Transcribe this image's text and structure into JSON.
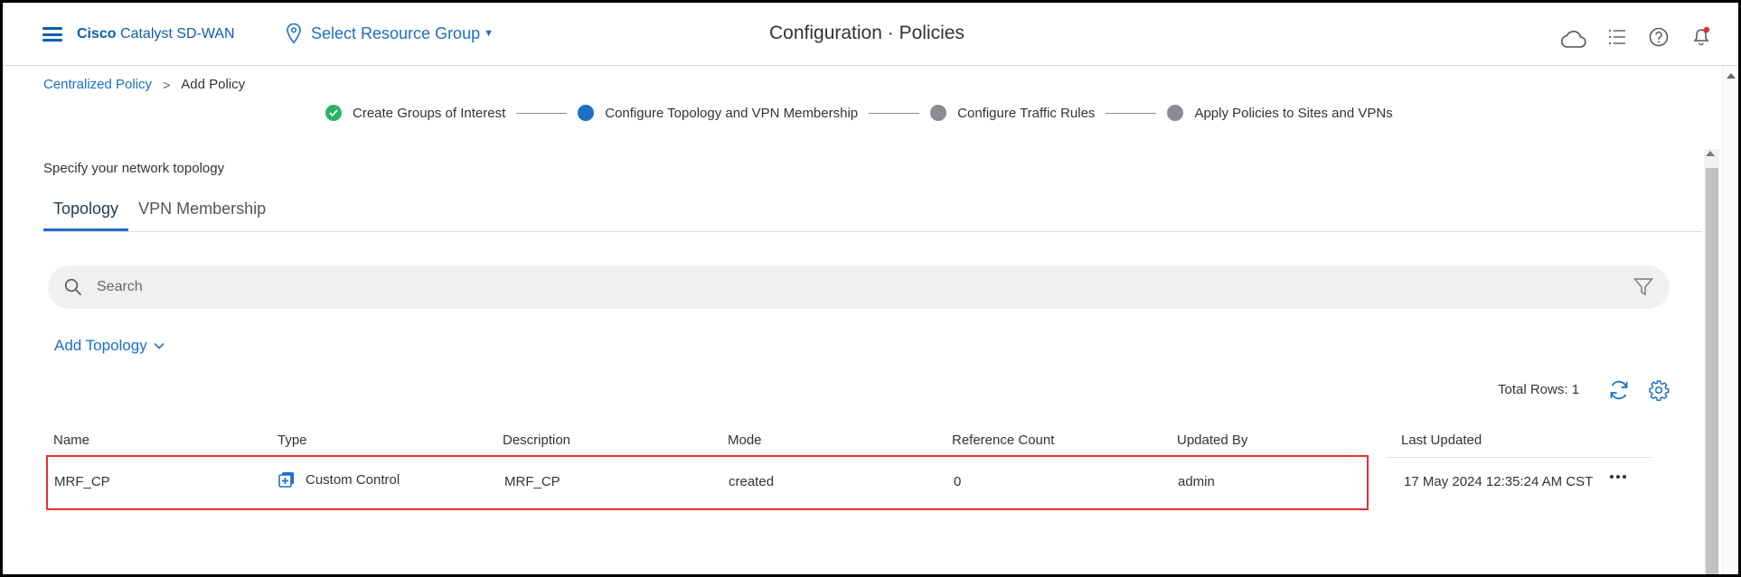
{
  "header": {
    "brand_bold": "Cisco",
    "brand_rest": " Catalyst SD-WAN",
    "resource_group": "Select Resource Group",
    "title": "Configuration · Policies",
    "icons": [
      "menu-icon",
      "location-pin-icon",
      "cloud-icon",
      "task-list-icon",
      "help-icon",
      "notification-bell-icon"
    ],
    "accent_color": "#1d6fc4",
    "alert_color": "#e03131"
  },
  "breadcrumb": {
    "parent": "Centralized Policy",
    "current": "Add Policy"
  },
  "stepper": {
    "steps": [
      {
        "label": "Create Groups of Interest",
        "state": "done"
      },
      {
        "label": "Configure Topology and VPN Membership",
        "state": "active"
      },
      {
        "label": "Configure Traffic Rules",
        "state": "pending"
      },
      {
        "label": "Apply Policies to Sites and VPNs",
        "state": "pending"
      }
    ]
  },
  "main": {
    "instruction": "Specify your network topology",
    "tabs": [
      {
        "label": "Topology",
        "active": true
      },
      {
        "label": "VPN Membership",
        "active": false
      }
    ],
    "search_placeholder": "Search",
    "add_topology_label": "Add Topology",
    "total_rows": "Total Rows: 1"
  },
  "table": {
    "columns": [
      "Name",
      "Type",
      "Description",
      "Mode",
      "Reference Count",
      "Updated By",
      "Last Updated"
    ],
    "rows": [
      {
        "name": "MRF_CP",
        "type": "Custom Control",
        "description": "MRF_CP",
        "mode": "created",
        "reference_count": "0",
        "updated_by": "admin",
        "last_updated": "17 May 2024 12:35:24 AM CST"
      }
    ]
  }
}
